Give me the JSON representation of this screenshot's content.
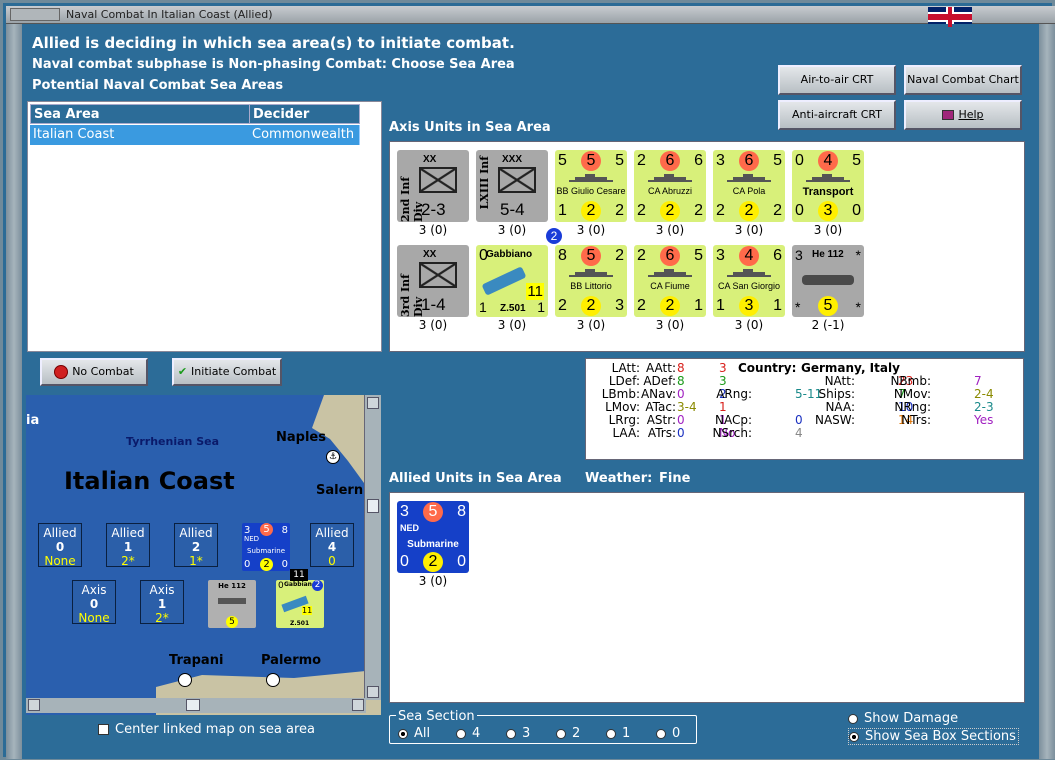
{
  "window": {
    "title": "Naval Combat In Italian Coast (Allied)"
  },
  "header": {
    "line1": "Allied is deciding in which sea area(s) to initiate combat.",
    "line2": "Naval combat subphase is Non-phasing Combat: Choose Sea Area",
    "line3": "Potential Naval Combat Sea Areas"
  },
  "buttons": {
    "air_to_air": "Air-to-air CRT",
    "naval_chart": "Naval Combat Chart",
    "anti_aircraft": "Anti-aircraft CRT",
    "help": "Help",
    "no_combat": "No Combat",
    "initiate_combat": "Initiate Combat"
  },
  "sea_table": {
    "headers": [
      "Sea Area",
      "Decider"
    ],
    "rows": [
      [
        "Italian Coast",
        "Commonwealth"
      ]
    ]
  },
  "axis_title": "Axis Units in Sea Area",
  "allied_title": "Allied Units in Sea Area",
  "weather_label": "Weather:",
  "weather_value": "Fine",
  "axis_units": [
    {
      "kind": "land",
      "name": "2nd Inf Div",
      "size": "XX",
      "strength": "2-3",
      "sub": "3 (0)"
    },
    {
      "kind": "land",
      "name": "LXIII Inf",
      "size": "XXX",
      "strength": "5-4",
      "sub": "3 (0)"
    },
    {
      "kind": "ship",
      "tl": "5",
      "tc": "5",
      "tr": "5",
      "name": "BB Giulio Cesare",
      "bl": "1",
      "bc": "2",
      "br": "2",
      "sub": "3 (0)"
    },
    {
      "kind": "ship",
      "tl": "2",
      "tc": "6",
      "tr": "6",
      "name": "CA Abruzzi",
      "bl": "2",
      "bc": "2",
      "br": "2",
      "sub": "3 (0)"
    },
    {
      "kind": "ship",
      "tl": "3",
      "tc": "6",
      "tr": "5",
      "name": "CA Pola",
      "bl": "2",
      "bc": "2",
      "br": "2",
      "sub": "3 (0)"
    },
    {
      "kind": "ship",
      "tl": "0",
      "tc": "4",
      "tr": "5",
      "name": "Transport",
      "bl": "0",
      "bc": "3",
      "br": "0",
      "sub": "3 (0)"
    },
    {
      "kind": "land",
      "name": "3rd Inf Div",
      "size": "XX",
      "strength": "1-4",
      "sub": "3 (0)"
    },
    {
      "kind": "air",
      "tl": "0",
      "tc": "2",
      "name": "Gabbiano",
      "code": "Z.501",
      "bl": "1",
      "bc": "11",
      "br": "1",
      "sub": "3 (0)"
    },
    {
      "kind": "ship",
      "tl": "8",
      "tc": "5",
      "tr": "2",
      "name": "BB Littorio",
      "bl": "2",
      "bc": "2",
      "br": "3",
      "sub": "3 (0)"
    },
    {
      "kind": "ship",
      "tl": "2",
      "tc": "6",
      "tr": "5",
      "name": "CA Fiume",
      "bl": "2",
      "bc": "2",
      "br": "1",
      "sub": "3 (0)"
    },
    {
      "kind": "ship",
      "tl": "3",
      "tc": "4",
      "tr": "6",
      "name": "CA San Giorgio",
      "bl": "1",
      "bc": "3",
      "br": "1",
      "sub": "3 (0)"
    },
    {
      "kind": "plane",
      "tl": "3",
      "name": "He 112",
      "tr": "*",
      "bl": "*",
      "bc": "5",
      "br": "*",
      "sub": "2 (-1)"
    }
  ],
  "allied_units": [
    {
      "tl": "3",
      "tc": "5",
      "tr": "8",
      "nation": "NED",
      "name": "Submarine",
      "bl": "0",
      "bc": "2",
      "br": "0",
      "sub": "3 (0)"
    }
  ],
  "stats": {
    "country_label": "Country:",
    "country_value": "Germany, Italy",
    "items": [
      [
        "LAtt:",
        "8"
      ],
      [
        "LDef:",
        "8"
      ],
      [
        "LBmb:",
        "0"
      ],
      [
        "LMov:",
        "3-4"
      ],
      [
        "LRrg:",
        "0"
      ],
      [
        "LAA:",
        "0"
      ],
      [
        "AAtt:",
        "3"
      ],
      [
        "ADef:",
        "3"
      ],
      [
        "ANav:",
        "2"
      ],
      [
        "ATac:",
        "1"
      ],
      [
        "AStr:",
        "1"
      ],
      [
        "ATrs:",
        "No"
      ],
      [
        "ARng:",
        "5-11"
      ],
      [
        "NACp:",
        "0"
      ],
      [
        "NSrch:",
        "4"
      ],
      [
        "NAtt:",
        "23"
      ],
      [
        "Ships:",
        "7"
      ],
      [
        "NAA:",
        "10"
      ],
      [
        "NASW:",
        "14"
      ],
      [
        "NBmb:",
        "7"
      ],
      [
        "NMov:",
        "2-4"
      ],
      [
        "NRng:",
        "2-3"
      ],
      [
        "NTrs:",
        "Yes"
      ]
    ],
    "colors": {
      "red": "#d8201c",
      "green": "#1a9a1a",
      "purple": "#a020c0",
      "olive": "#8a8a00",
      "blue": "#1a30c0",
      "teal": "#1a8a8a",
      "orange": "#e07a10",
      "gray": "#888888"
    }
  },
  "map": {
    "area_name": "Italian Coast",
    "labels": {
      "sea": "Tyrrhenian Sea",
      "naples": "Naples",
      "salerno": "Salern",
      "trapani": "Trapani",
      "palermo": "Palermo",
      "ia": "ia"
    },
    "allied_boxes": [
      [
        "Allied",
        "0",
        "None"
      ],
      [
        "Allied",
        "1",
        "2*"
      ],
      [
        "Allied",
        "2",
        "1*"
      ],
      [
        "Allied",
        "4",
        "0"
      ]
    ],
    "axis_boxes": [
      [
        "Axis",
        "0",
        "None"
      ],
      [
        "Axis",
        "1",
        "2*"
      ]
    ],
    "stack_count": "11",
    "mini_sub": {
      "tl": "3",
      "tc": "5",
      "tr": "8",
      "nation": "NED",
      "name": "Submarine",
      "bl": "0",
      "bc": "2",
      "br": "0"
    },
    "mini_plane": {
      "name": "He 112",
      "bc": "5"
    },
    "mini_air": {
      "tl": "0",
      "name": "Gabbiano",
      "tc": "2",
      "code": "Z.501",
      "bc": "11"
    }
  },
  "center_linked": "Center linked map on sea area",
  "sea_section": {
    "title": "Sea Section",
    "options": [
      "All",
      "4",
      "3",
      "2",
      "1",
      "0"
    ],
    "selected": "All"
  },
  "options": {
    "show_damage": "Show Damage",
    "show_sea_box": "Show Sea Box Sections",
    "selected": "show_sea_box"
  }
}
